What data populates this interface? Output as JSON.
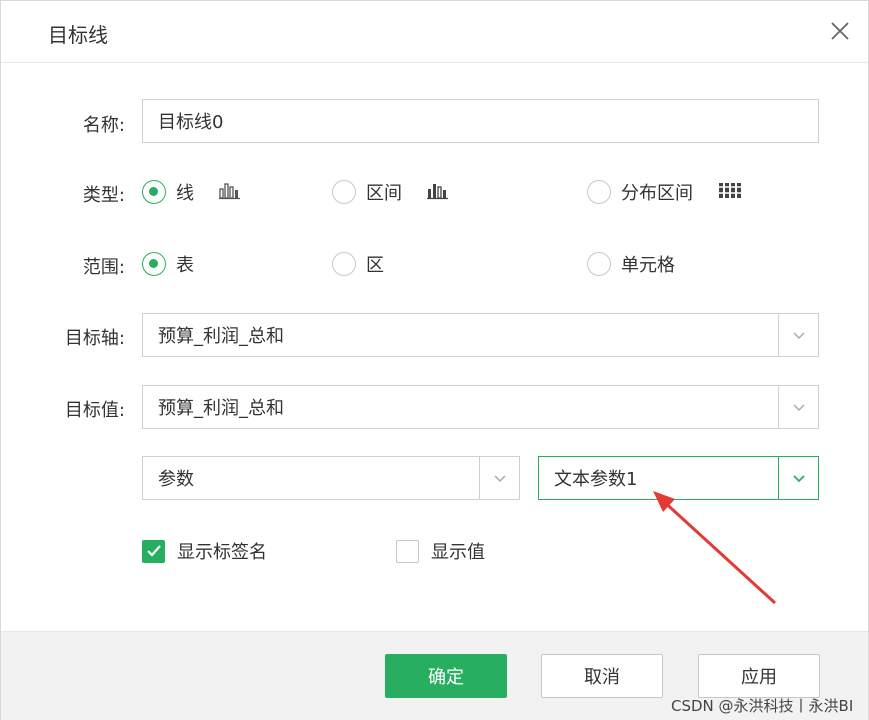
{
  "dialog": {
    "title": "目标线",
    "close_icon": "close-icon"
  },
  "form": {
    "name": {
      "label": "名称:",
      "value": "目标线0"
    },
    "type": {
      "label": "类型:",
      "options": [
        {
          "label": "线",
          "checked": true,
          "icon": "bar-chart-icon"
        },
        {
          "label": "区间",
          "checked": false,
          "icon": "bar-chart-icon"
        },
        {
          "label": "分布区间",
          "checked": false,
          "icon": "distribution-chart-icon"
        }
      ]
    },
    "scope": {
      "label": "范围:",
      "options": [
        {
          "label": "表",
          "checked": true
        },
        {
          "label": "区",
          "checked": false
        },
        {
          "label": "单元格",
          "checked": false
        }
      ]
    },
    "target_axis": {
      "label": "目标轴:",
      "value": "预算_利润_总和"
    },
    "target_value": {
      "label": "目标值:",
      "value": "预算_利润_总和"
    },
    "param_type": {
      "value": "参数"
    },
    "param_name": {
      "value": "文本参数1"
    },
    "show_label_name": {
      "label": "显示标签名",
      "checked": true
    },
    "show_value": {
      "label": "显示值",
      "checked": false
    }
  },
  "footer": {
    "ok": "确定",
    "cancel": "取消",
    "apply": "应用"
  },
  "watermark": "CSDN @永洪科技丨永洪BI",
  "colors": {
    "accent": "#27ae60",
    "annotation_arrow": "#e53935"
  }
}
